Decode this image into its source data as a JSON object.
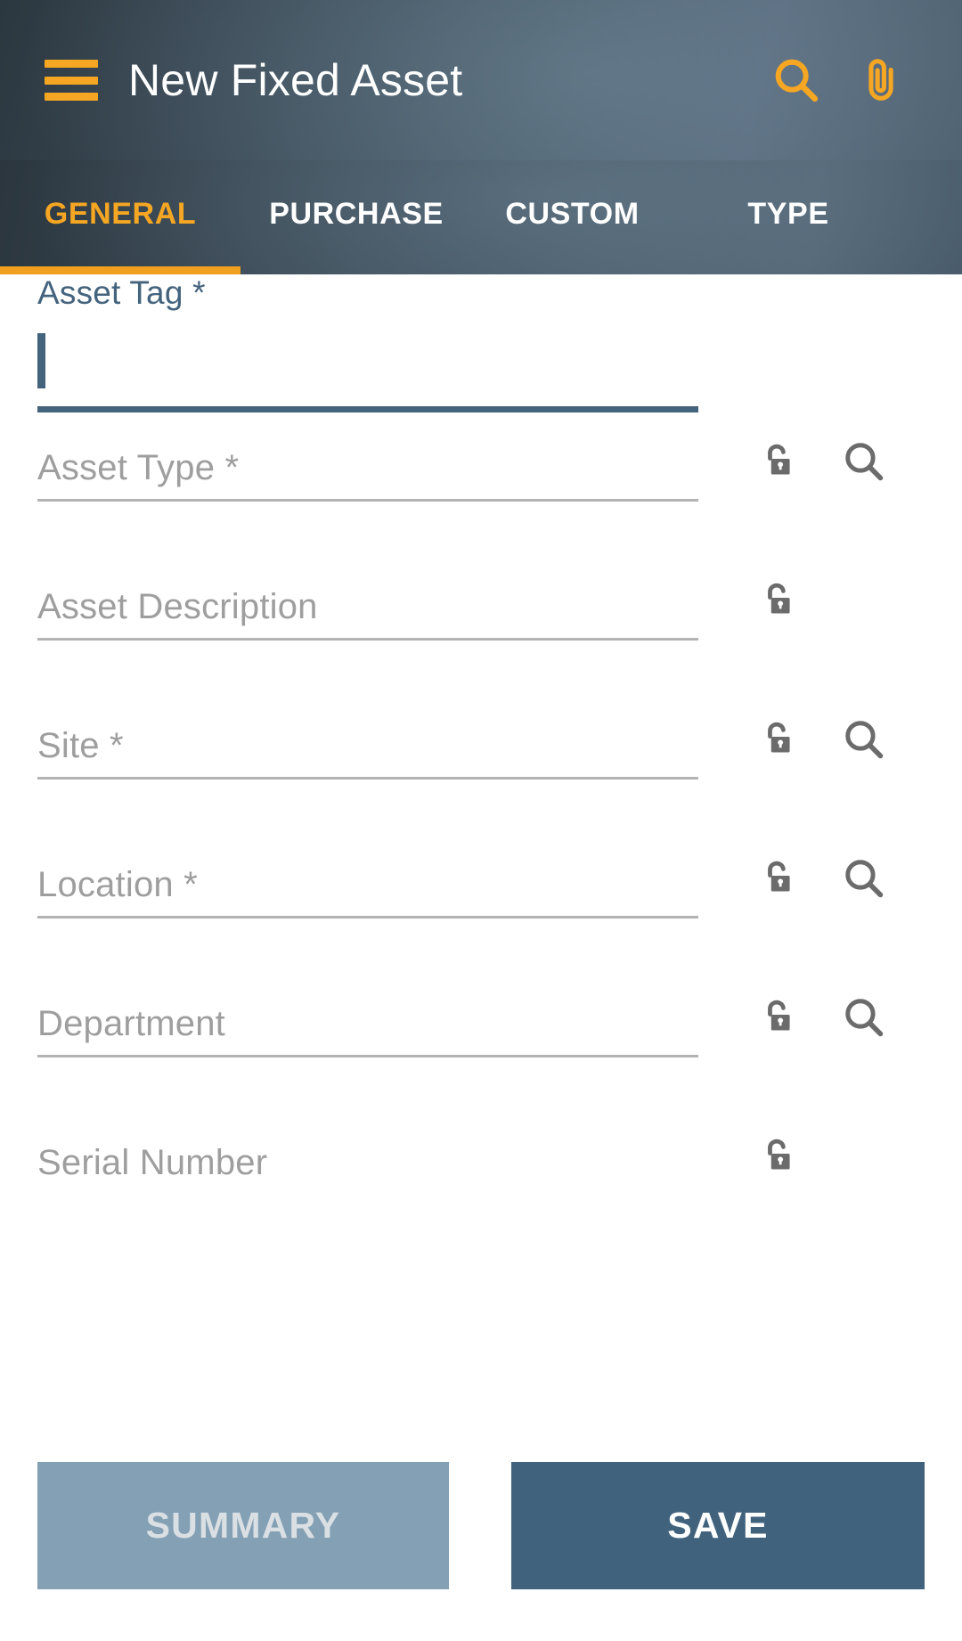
{
  "appbar": {
    "menu_icon": "hamburger-menu-icon",
    "title": "New Fixed Asset",
    "search_icon": "search-icon",
    "attachment_icon": "paperclip-icon",
    "accent_color": "#F5A623"
  },
  "tabs": {
    "active_index": 0,
    "items": [
      {
        "label": "GENERAL"
      },
      {
        "label": "PURCHASE"
      },
      {
        "label": "CUSTOM"
      },
      {
        "label": "TYPE"
      }
    ]
  },
  "form": {
    "fields": [
      {
        "label": "Asset Tag *",
        "value": "",
        "placeholder": "",
        "focused": true,
        "label_above": true,
        "lock_icon": "",
        "search_icon": ""
      },
      {
        "label": "",
        "value": "",
        "placeholder": "Asset Type *",
        "focused": false,
        "label_above": false,
        "lock_icon": "unlock-icon",
        "search_icon": "search-icon"
      },
      {
        "label": "",
        "value": "",
        "placeholder": "Asset Description",
        "focused": false,
        "label_above": false,
        "lock_icon": "unlock-icon",
        "search_icon": ""
      },
      {
        "label": "",
        "value": "",
        "placeholder": "Site *",
        "focused": false,
        "label_above": false,
        "lock_icon": "unlock-icon",
        "search_icon": "search-icon"
      },
      {
        "label": "",
        "value": "",
        "placeholder": "Location *",
        "focused": false,
        "label_above": false,
        "lock_icon": "unlock-icon",
        "search_icon": "search-icon"
      },
      {
        "label": "",
        "value": "",
        "placeholder": "Department",
        "focused": false,
        "label_above": false,
        "lock_icon": "unlock-icon",
        "search_icon": "search-icon"
      },
      {
        "label": "",
        "value": "",
        "placeholder": "Serial Number",
        "focused": false,
        "label_above": false,
        "lock_icon": "unlock-icon",
        "search_icon": ""
      }
    ]
  },
  "footer": {
    "summary_label": "SUMMARY",
    "save_label": "SAVE",
    "summary_color": "#83a0b4",
    "save_color": "#41627d"
  }
}
